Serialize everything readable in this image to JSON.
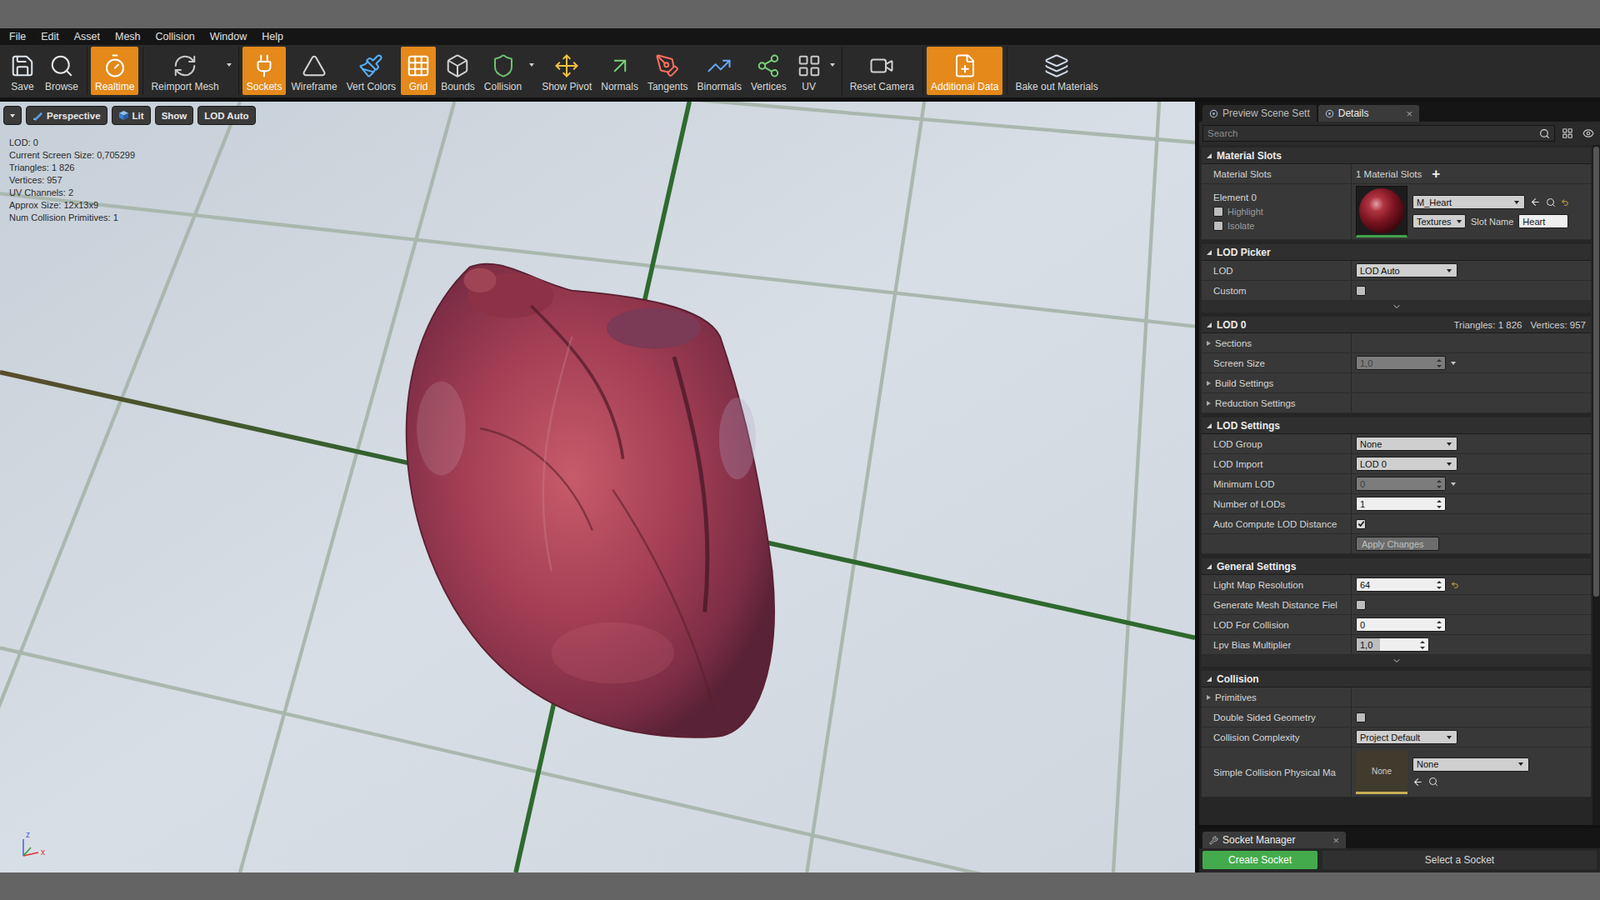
{
  "menu": [
    "File",
    "Edit",
    "Asset",
    "Mesh",
    "Collision",
    "Window",
    "Help"
  ],
  "toolbar": [
    [
      {
        "label": "Save",
        "active": false,
        "dropdown": false
      },
      {
        "label": "Browse",
        "active": false,
        "dropdown": false
      }
    ],
    [
      {
        "label": "Realtime",
        "active": true,
        "dropdown": false
      }
    ],
    [
      {
        "label": "Reimport Mesh",
        "active": false,
        "dropdown": true
      }
    ],
    [
      {
        "label": "Sockets",
        "active": true,
        "dropdown": false
      },
      {
        "label": "Wireframe",
        "active": false,
        "dropdown": false
      },
      {
        "label": "Vert Colors",
        "active": false,
        "dropdown": false
      },
      {
        "label": "Grid",
        "active": true,
        "dropdown": false
      },
      {
        "label": "Bounds",
        "active": false,
        "dropdown": false
      },
      {
        "label": "Collision",
        "active": false,
        "dropdown": true
      },
      {
        "label": "Show Pivot",
        "active": false,
        "dropdown": false
      },
      {
        "label": "Normals",
        "active": false,
        "dropdown": false
      },
      {
        "label": "Tangents",
        "active": false,
        "dropdown": false
      },
      {
        "label": "Binormals",
        "active": false,
        "dropdown": false
      },
      {
        "label": "Vertices",
        "active": false,
        "dropdown": false
      },
      {
        "label": "UV",
        "active": false,
        "dropdown": true
      }
    ],
    [
      {
        "label": "Reset Camera",
        "active": false,
        "dropdown": false
      }
    ],
    [
      {
        "label": "Additional Data",
        "active": true,
        "dropdown": false
      }
    ],
    [
      {
        "label": "Bake out Materials",
        "active": false,
        "dropdown": false
      }
    ]
  ],
  "viewport": {
    "controls": [
      {
        "label": "Perspective"
      },
      {
        "label": "Lit"
      },
      {
        "label": "Show"
      },
      {
        "label": "LOD Auto"
      }
    ],
    "stats": [
      "LOD: 0",
      "Current Screen Size: 0,705299",
      "Triangles: 1 826",
      "Vertices: 957",
      "UV Channels: 2",
      "Approx Size: 12x13x9",
      "Num Collision Primitives: 1"
    ],
    "axes": [
      "z",
      "x"
    ]
  },
  "details": {
    "tabs": [
      {
        "label": "Preview Scene Sett",
        "selected": false
      },
      {
        "label": "Details",
        "selected": true,
        "close": "×"
      }
    ],
    "search": {
      "placeholder": "Search"
    },
    "sections": [
      {
        "title": "Material Slots",
        "expanded": true,
        "more": false,
        "rows": [
          {
            "kind": "count",
            "label": "Material Slots",
            "value": "1 Material Slots",
            "add": "+"
          },
          {
            "kind": "material",
            "label": "Element 0",
            "checks": [
              {
                "label": "Highlight",
                "checked": false
              },
              {
                "label": "Isolate",
                "checked": false
              }
            ],
            "material": "M_Heart",
            "textures": "Textures",
            "slot_label": "Slot Name",
            "slot_value": "Heart",
            "reset": true
          }
        ]
      },
      {
        "title": "LOD Picker",
        "expanded": true,
        "more": true,
        "rows": [
          {
            "kind": "dropdown",
            "label": "LOD",
            "value": "LOD Auto"
          },
          {
            "kind": "checkbox",
            "label": "Custom",
            "checked": false
          }
        ]
      },
      {
        "title": "LOD 0",
        "expanded": true,
        "more": false,
        "info": [
          "Triangles: 1 826",
          "Vertices: 957"
        ],
        "rows": [
          {
            "kind": "group",
            "label": "Sections",
            "expanded": false
          },
          {
            "kind": "number",
            "label": "Screen Size",
            "value": "1,0",
            "disabled": true,
            "menu": true,
            "reset": false
          },
          {
            "kind": "group",
            "label": "Build Settings",
            "expanded": false
          },
          {
            "kind": "group",
            "label": "Reduction Settings",
            "expanded": false
          }
        ]
      },
      {
        "title": "LOD Settings",
        "expanded": true,
        "more": false,
        "rows": [
          {
            "kind": "dropdown",
            "label": "LOD Group",
            "value": "None"
          },
          {
            "kind": "dropdown",
            "label": "LOD Import",
            "value": "LOD 0"
          },
          {
            "kind": "number",
            "label": "Minimum LOD",
            "value": "0",
            "disabled": true,
            "menu": true,
            "reset": false
          },
          {
            "kind": "number",
            "label": "Number of LODs",
            "value": "1",
            "disabled": false,
            "menu": false,
            "reset": false
          },
          {
            "kind": "checkbox",
            "label": "Auto Compute LOD Distance",
            "checked": true
          },
          {
            "kind": "button",
            "label": "Apply Changes",
            "disabled": true
          }
        ]
      },
      {
        "title": "General Settings",
        "expanded": true,
        "more": true,
        "rows": [
          {
            "kind": "number",
            "label": "Light Map Resolution",
            "value": "64",
            "disabled": false,
            "menu": false,
            "reset": true
          },
          {
            "kind": "checkbox",
            "label": "Generate Mesh Distance Fiel",
            "checked": false
          },
          {
            "kind": "number",
            "label": "LOD For Collision",
            "value": "0",
            "disabled": false,
            "menu": false,
            "reset": false
          },
          {
            "kind": "spin",
            "label": "Lpv Bias Multiplier",
            "value": "1,0",
            "level": 0.33
          }
        ]
      },
      {
        "title": "Collision",
        "expanded": true,
        "more": false,
        "rows": [
          {
            "kind": "group",
            "label": "Primitives",
            "expanded": false
          },
          {
            "kind": "checkbox",
            "label": "Double Sided Geometry",
            "checked": false
          },
          {
            "kind": "dropdown",
            "label": "Collision Complexity",
            "value": "Project Default"
          },
          {
            "kind": "asset",
            "label": "Simple Collision Physical Ma",
            "thumb": "None",
            "value": "None"
          }
        ]
      }
    ]
  },
  "socket_manager": {
    "tab": "Socket Manager",
    "close": "×",
    "create": "Create Socket",
    "hint": "Select a Socket"
  }
}
